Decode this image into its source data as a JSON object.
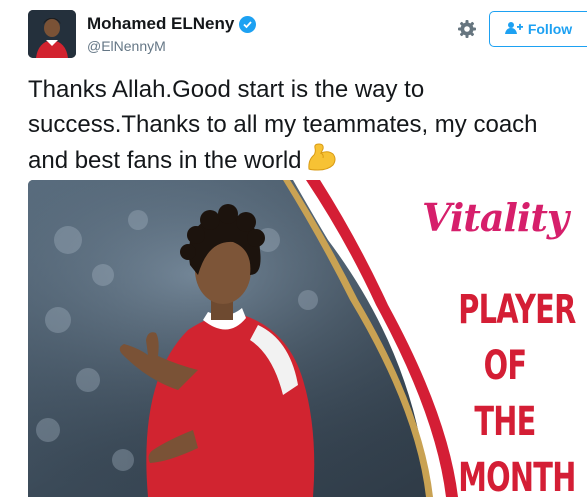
{
  "user": {
    "display_name": "Mohamed ELNeny",
    "handle": "@ElNennyM",
    "verified": true
  },
  "actions": {
    "follow_label": "Follow"
  },
  "tweet": {
    "text": "Thanks Allah.Good start is the way to success.Thanks to all my teammates, my coach and best fans in the world",
    "emoji": "flexed-biceps"
  },
  "media": {
    "brand_text": "Vitality",
    "award_lines": [
      "PLAYER",
      "OF THE",
      "MONTH"
    ]
  },
  "colors": {
    "accent_blue": "#1da1f2",
    "brand_pink": "#d61f6b",
    "award_red": "#d41e35"
  }
}
